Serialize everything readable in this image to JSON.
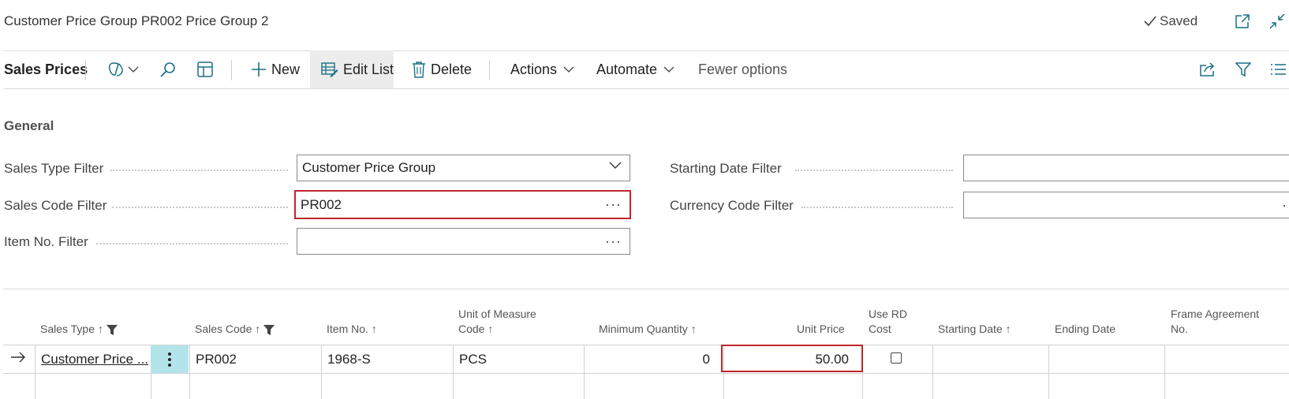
{
  "header": {
    "title": "Customer Price Group PR002 Price Group 2",
    "saved_label": "Saved"
  },
  "toolbar": {
    "page_title": "Sales Prices",
    "new_label": "New",
    "edit_list_label": "Edit List",
    "delete_label": "Delete",
    "actions_label": "Actions",
    "automate_label": "Automate",
    "fewer_options_label": "Fewer options"
  },
  "general": {
    "heading": "General",
    "sales_type_filter": {
      "label": "Sales Type Filter",
      "value": "Customer Price Group"
    },
    "sales_code_filter": {
      "label": "Sales Code Filter",
      "value": "PR002"
    },
    "item_no_filter": {
      "label": "Item No. Filter",
      "value": ""
    },
    "starting_date_filter": {
      "label": "Starting Date Filter",
      "value": ""
    },
    "currency_code_filter": {
      "label": "Currency Code Filter",
      "value": ""
    }
  },
  "grid": {
    "columns": {
      "sales_type": "Sales Type",
      "sales_code": "Sales Code",
      "item_no": "Item No.",
      "uom_line1": "Unit of Measure",
      "uom_line2": "Code",
      "min_qty": "Minimum Quantity",
      "unit_price": "Unit Price",
      "use_rd_line1": "Use RD",
      "use_rd_line2": "Cost",
      "starting_date": "Starting Date",
      "ending_date": "Ending Date",
      "frame_line1": "Frame Agreement",
      "frame_line2": "No."
    },
    "rows": [
      {
        "sales_type": "Customer Price ...",
        "sales_code": "PR002",
        "item_no": "1968-S",
        "uom": "PCS",
        "min_qty": "0",
        "unit_price": "50.00",
        "use_rd_cost": false,
        "starting_date": "",
        "ending_date": "",
        "frame_agreement_no": ""
      }
    ]
  },
  "colors": {
    "error_border": "#c0262d",
    "accent": "#1a6f86",
    "selected_cell": "#b2e4ea"
  }
}
